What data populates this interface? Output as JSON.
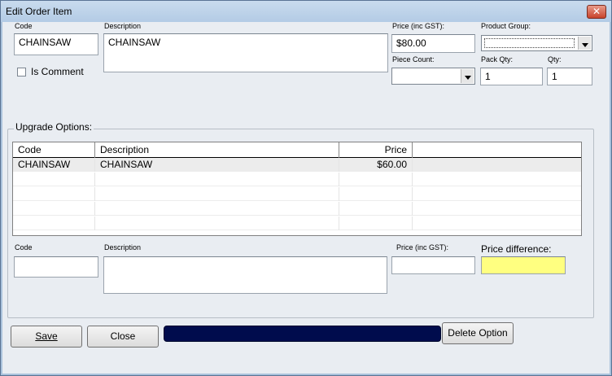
{
  "window": {
    "title": "Edit Order Item",
    "close_glyph": "✕"
  },
  "item": {
    "code_label": "Code",
    "code_value": "CHAINSAW",
    "description_label": "Description",
    "description_value": "CHAINSAW",
    "price_label": "Price (inc GST):",
    "price_value": "$80.00",
    "product_group_label": "Product Group:",
    "product_group_value": "",
    "piece_count_label": "Piece Count:",
    "piece_count_value": "",
    "pack_qty_label": "Pack Qty:",
    "pack_qty_value": "1",
    "qty_label": "Qty:",
    "qty_value": "1",
    "is_comment_label": "Is Comment",
    "is_comment_checked": false
  },
  "upgrade_options": {
    "group_title": "Upgrade Options:",
    "columns": [
      "Code",
      "Description",
      "Price"
    ],
    "rows": [
      {
        "code": "CHAINSAW",
        "description": "CHAINSAW",
        "price": "$60.00"
      }
    ],
    "new_code_label": "Code",
    "new_code_value": "",
    "new_description_label": "Description",
    "new_description_value": "",
    "new_price_label": "Price (inc GST):",
    "new_price_value": "",
    "price_difference_label": "Price difference:",
    "price_difference_value": "",
    "price_difference_color": "#ffff80"
  },
  "buttons": {
    "save": "Save",
    "close": "Close",
    "delete_option": "Delete Option"
  },
  "colors": {
    "progress_fill": "#000c4d",
    "title_bar": "#b3cbe5"
  }
}
